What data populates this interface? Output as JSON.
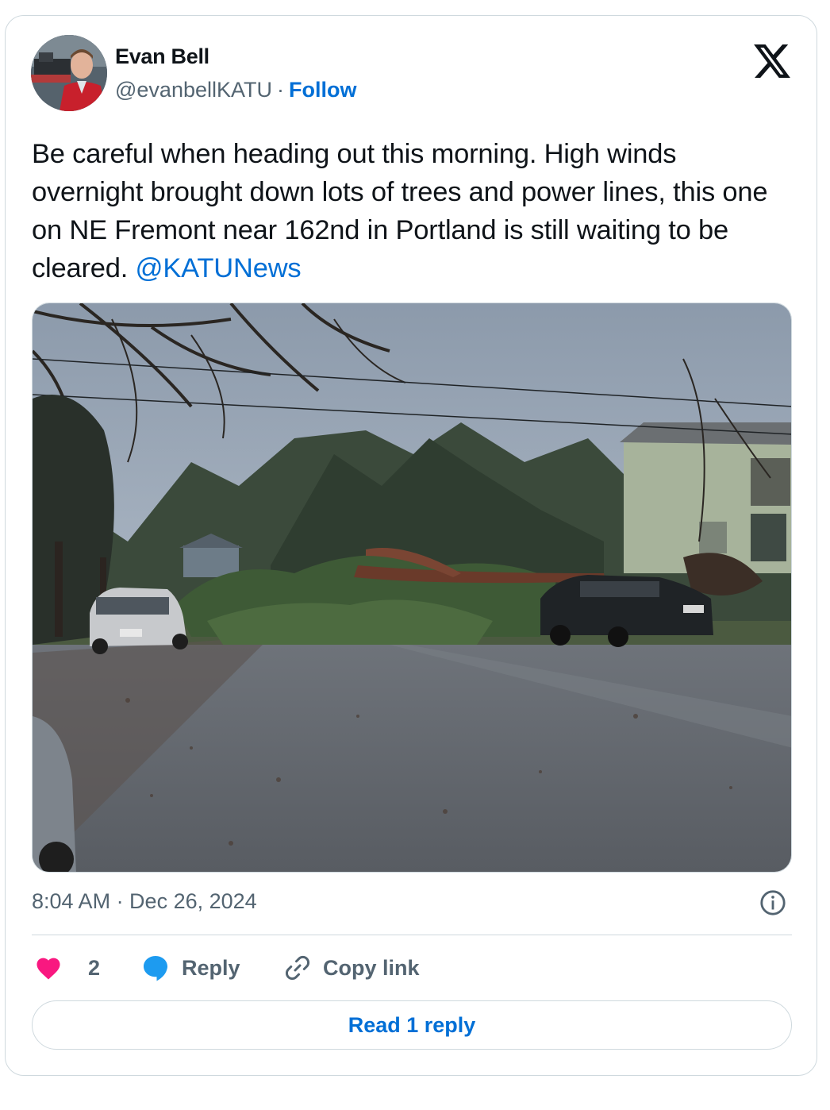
{
  "author": {
    "name": "Evan Bell",
    "handle": "@evanbellKATU",
    "separator": "·",
    "follow_label": "Follow"
  },
  "tweet": {
    "text": "Be careful when heading out this morning. High winds overnight brought down lots of trees and power lines, this one on NE Fremont near 162nd in Portland is still waiting to be cleared. ",
    "mention": "@KATUNews",
    "timestamp": "8:04 AM · Dec 26, 2024"
  },
  "actions": {
    "like_count": "2",
    "reply_label": "Reply",
    "copy_link_label": "Copy link"
  },
  "read_replies_label": "Read 1 reply",
  "icons": {
    "logo": "x-logo-icon",
    "like": "heart-icon",
    "reply": "speech-bubble-icon",
    "copy": "link-icon",
    "info": "info-icon"
  },
  "colors": {
    "link": "#006fd6",
    "like": "#f91880",
    "reply": "#1d9bf0",
    "secondary_text": "#536471",
    "border": "#cfd9de"
  }
}
